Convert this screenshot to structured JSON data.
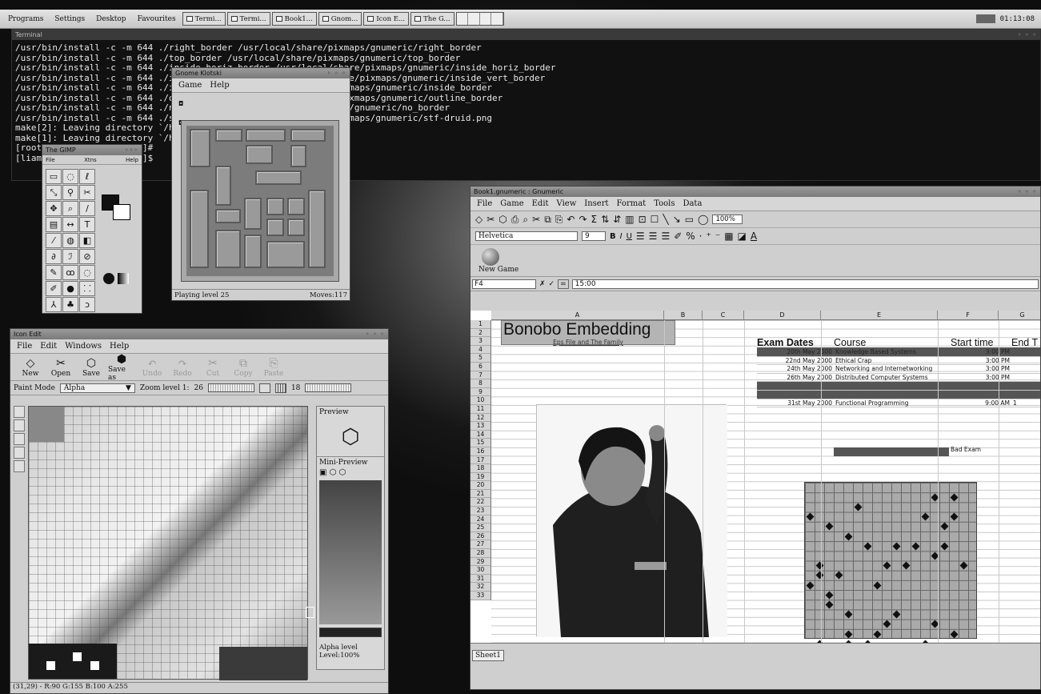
{
  "panel": {
    "menus": [
      "Programs",
      "Settings",
      "Desktop",
      "Favourites"
    ],
    "tasks": [
      "Termi...",
      "Termi...",
      "Book1...",
      "Gnom...",
      "Icon E...",
      "The G..."
    ],
    "clock": "01:13:08"
  },
  "terminal": {
    "title": "Terminal",
    "lines": [
      "/usr/bin/install -c -m 644 ./right_border /usr/local/share/pixmaps/gnumeric/right_border",
      "/usr/bin/install -c -m 644 ./top_border /usr/local/share/pixmaps/gnumeric/top_border",
      "/usr/bin/install -c -m 644 ./inside_horiz_border /usr/local/share/pixmaps/gnumeric/inside_horiz_border",
      "/usr/bin/install -c -m 644 ./inside_vert_border /usr/local/share/pixmaps/gnumeric/inside_vert_border",
      "/usr/bin/install -c -m 644 ./inside_border /usr/local/share/pixmaps/gnumeric/inside_border",
      "/usr/bin/install -c -m 644 ./outline_border /usr/local/share/pixmaps/gnumeric/outline_border",
      "/usr/bin/install -c -m 644 ./no_border /usr/local/share/pixmaps/gnumeric/no_border",
      "/usr/bin/install -c -m 644 ./stf-druid.png /usr/local/share/pixmaps/gnumeric/stf-druid.png",
      "make[2]: Leaving directory `/home/gnumeric/icons'",
      "make[1]: Leaving directory `/home/gnumeric/icons'",
      "[root@localhost gnumeric]#",
      "[liam@localhost gnumeric]$"
    ]
  },
  "klotski": {
    "title": "Gnome Klotski",
    "menu": [
      "Game",
      "Help"
    ],
    "status_level": "Playing level 25",
    "status_moves": "Moves:117"
  },
  "toolbox": {
    "title": "The GIMP",
    "menu": [
      "File",
      "Xtns",
      "Help"
    ],
    "tools": [
      "▭",
      "◌",
      "ℓ",
      "⤡",
      "⚲",
      "✂",
      "✥",
      "⌕",
      "/",
      "▤",
      "↔",
      "T",
      "⁄",
      "◍",
      "◧",
      "∂",
      "ℐ",
      "⊘",
      "✎",
      "ꝏ",
      "◌",
      "✐",
      "●",
      "⸬",
      "⅄",
      "♣",
      "ↄ"
    ]
  },
  "iconedit": {
    "title": "Icon Edit",
    "menu": [
      "File",
      "Edit",
      "Windows",
      "Help"
    ],
    "toolbar": [
      {
        "icon": "◇",
        "label": "New"
      },
      {
        "icon": "✂",
        "label": "Open"
      },
      {
        "icon": "⬡",
        "label": "Save"
      },
      {
        "icon": "⬢",
        "label": "Save as"
      },
      {
        "icon": "↶",
        "label": "Undo"
      },
      {
        "icon": "↷",
        "label": "Redo"
      },
      {
        "icon": "✂",
        "label": "Cut"
      },
      {
        "icon": "⧉",
        "label": "Copy"
      },
      {
        "icon": "⎘",
        "label": "Paste"
      }
    ],
    "paint_mode_label": "Paint Mode",
    "paint_mode_value": "Alpha",
    "zoom_label": "Zoom level 1:",
    "zoom_value": "26",
    "grid_value": "18",
    "preview_label": "Preview",
    "mini_preview_label": "Mini-Preview",
    "alpha_label": "Alpha level",
    "alpha_value": "Level:100%",
    "status": "(31,29) - R:90 G:155 B:100 A:255"
  },
  "gnumeric": {
    "title": "Book1.gnumeric : Gnumeric",
    "menu": [
      "File",
      "Game",
      "Edit",
      "View",
      "Insert",
      "Format",
      "Tools",
      "Data"
    ],
    "zoom": "100%",
    "font_name": "Helvetica",
    "font_size": "9",
    "new_game_label": "New Game",
    "cell_ref": "F4",
    "formula": "15:00",
    "columns": [
      "A",
      "B",
      "C",
      "D",
      "E",
      "F",
      "G"
    ],
    "rows": [
      "1",
      "2",
      "3",
      "4",
      "5",
      "6",
      "7",
      "8",
      "9",
      "10",
      "11",
      "12",
      "13",
      "14",
      "15",
      "16",
      "17",
      "18",
      "19",
      "20",
      "21",
      "22",
      "23",
      "24",
      "25",
      "26",
      "27",
      "28",
      "29",
      "30",
      "31",
      "32",
      "33"
    ],
    "bonobo_title": "Bonobo Embedding",
    "bonobo_link": "Eps File and The Family",
    "exam_headers": [
      "Exam Dates",
      "Course",
      "Start time",
      "End T"
    ],
    "exams": [
      {
        "date": "20th May 2000",
        "course": "Knowledge Based Systems",
        "start": "3:00 PM",
        "end": ""
      },
      {
        "date": "22nd May 2000",
        "course": "Ethical Crap",
        "start": "3:00 PM",
        "end": ""
      },
      {
        "date": "24th May 2000",
        "course": "Networking and Internetworking",
        "start": "3:00 PM",
        "end": ""
      },
      {
        "date": "26th May 2000",
        "course": "Distributed Computer Systems",
        "start": "3:00 PM",
        "end": ""
      },
      {
        "date": "",
        "course": "",
        "start": "",
        "end": ""
      },
      {
        "date": "",
        "course": "",
        "start": "",
        "end": ""
      },
      {
        "date": "31st May 2000",
        "course": "Functional Programming",
        "start": "9:00 AM",
        "end": "1"
      }
    ],
    "bad_exam": "Bad Exam",
    "sheet_tab": "Sheet1"
  }
}
